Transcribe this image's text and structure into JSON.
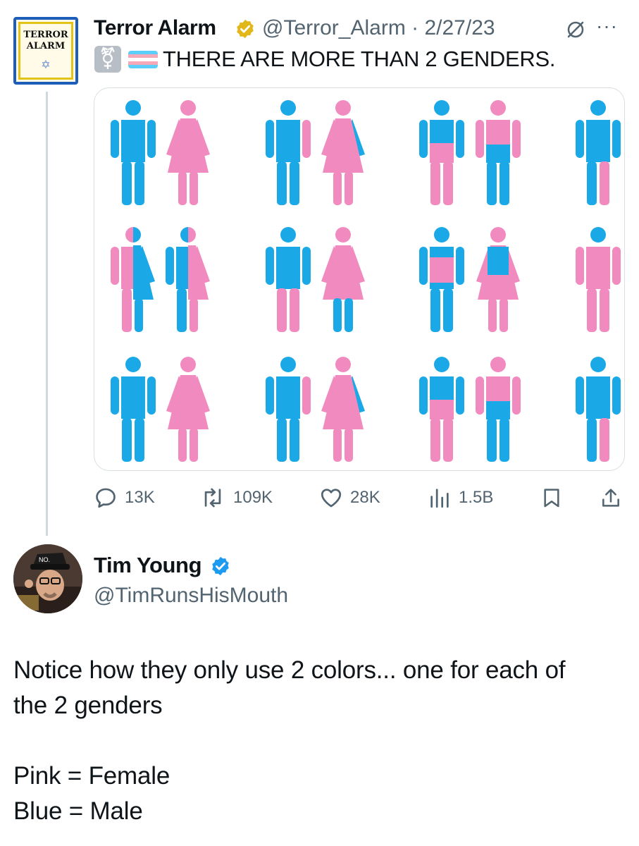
{
  "tweet": {
    "avatar_text_line1": "TERROR",
    "avatar_text_line2": "ALARM",
    "avatar_star": "✡",
    "author_name": "Terror Alarm",
    "verified_icon": "gold-check-badge-icon",
    "handle_date": "@Terror_Alarm · 2/27/23",
    "emoji_symbol": "⚧",
    "emoji_flag": "transgender-flag",
    "text": "THERE ARE MORE THAN 2 GENDERS.",
    "stats": {
      "replies": "13K",
      "reposts": "109K",
      "likes": "28K",
      "views": "1.5B"
    },
    "colors": {
      "blue": "#1aa8e6",
      "pink": "#f18bbf",
      "flag_blue": "#5bcefa",
      "flag_pink": "#f5a9b8"
    }
  },
  "reply": {
    "author_name": "Tim Young",
    "verified_icon": "blue-check-badge-icon",
    "handle": "@TimRunsHisMouth",
    "hat_text": "NO.",
    "body_line1": "Notice how they only use 2 colors... one for each of",
    "body_line2": "the 2 genders",
    "body_line3": "Pink = Female",
    "body_line4": "Blue = Male"
  }
}
